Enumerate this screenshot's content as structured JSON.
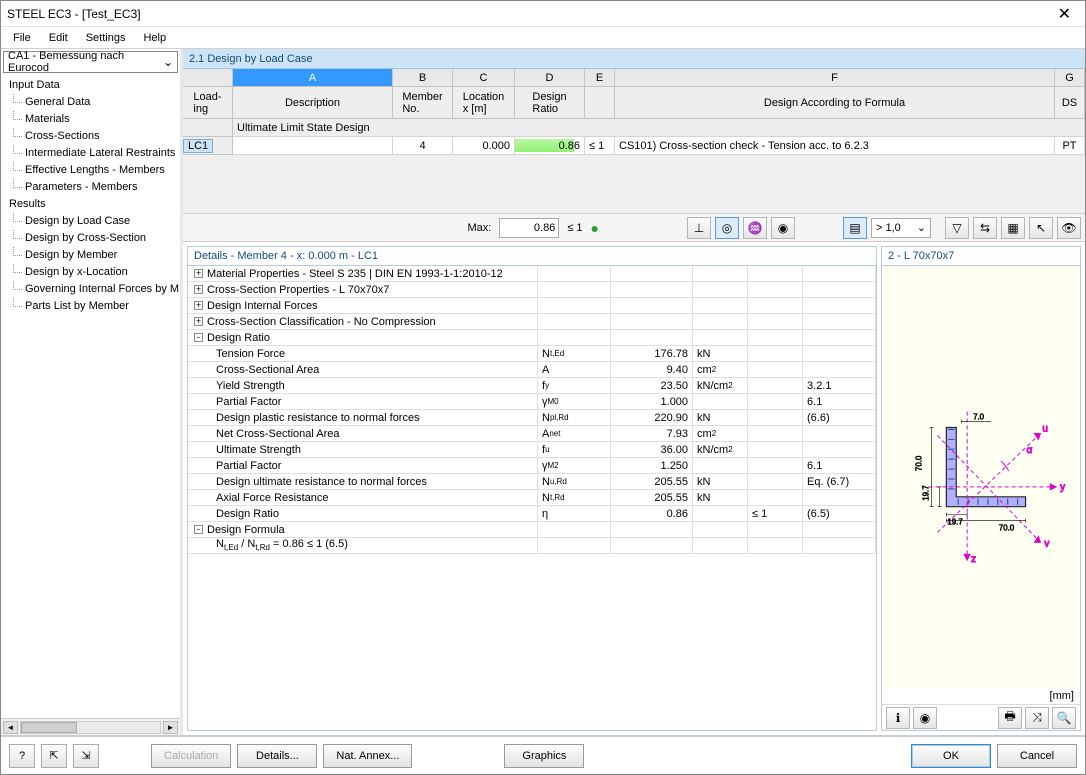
{
  "window": {
    "title": "STEEL EC3 - [Test_EC3]"
  },
  "menu": {
    "file": "File",
    "edit": "Edit",
    "settings": "Settings",
    "help": "Help"
  },
  "case_combo": "CA1 - Bemessung nach Eurocod",
  "nav": {
    "input": "Input Data",
    "general": "General Data",
    "materials": "Materials",
    "xsections": "Cross-Sections",
    "ilr": "Intermediate Lateral Restraints",
    "efflen": "Effective Lengths - Members",
    "params": "Parameters - Members",
    "results": "Results",
    "dlc": "Design by Load Case",
    "dcs": "Design by Cross-Section",
    "dmem": "Design by Member",
    "dxloc": "Design by x-Location",
    "gif": "Governing Internal Forces by M",
    "pl": "Parts List by Member"
  },
  "section_title": "2.1 Design by Load Case",
  "grid": {
    "hdr_loading": "Load-\ning",
    "hdr_desc": "Description",
    "hdr_member": "Member\nNo.",
    "hdr_loc": "Location\nx [m]",
    "hdr_design": "Design\nRatio",
    "hdr_formula": "Design According to Formula",
    "hdr_ds": "DS",
    "section_row": "Ultimate Limit State Design",
    "row": {
      "lc": "LC1",
      "desc": "",
      "memno": "4",
      "x": "0.000",
      "ratio": "0.86",
      "check": "≤ 1",
      "formula": "CS101) Cross-section check - Tension acc. to 6.2.3",
      "ds": "PT"
    }
  },
  "summary": {
    "max_label": "Max:",
    "max_val": "0.86",
    "check": "≤ 1",
    "filter_val": "> 1,0"
  },
  "details": {
    "title": "Details - Member 4 - x: 0.000 m - LC1",
    "rows": [
      {
        "exp": "+",
        "name": "Material Properties - Steel S 235 | DIN EN 1993-1-1:2010-12"
      },
      {
        "exp": "+",
        "name": "Cross-Section Properties  -  L 70x70x7"
      },
      {
        "exp": "+",
        "name": "Design Internal Forces"
      },
      {
        "exp": "+",
        "name": "Cross-Section Classification - No Compression"
      },
      {
        "exp": "-",
        "name": "Design Ratio"
      },
      {
        "indent": 2,
        "name": "Tension Force",
        "sym": "N_t,Ed",
        "val": "176.78",
        "unit": "kN"
      },
      {
        "indent": 2,
        "name": "Cross-Sectional Area",
        "sym": "A",
        "val": "9.40",
        "unit": "cm²"
      },
      {
        "indent": 2,
        "name": "Yield Strength",
        "sym": "f_y",
        "val": "23.50",
        "unit": "kN/cm²",
        "ref": "3.2.1"
      },
      {
        "indent": 2,
        "name": "Partial Factor",
        "sym": "γ_M0",
        "val": "1.000",
        "ref": "6.1"
      },
      {
        "indent": 2,
        "name": "Design plastic resistance to normal forces",
        "sym": "N_pl,Rd",
        "val": "220.90",
        "unit": "kN",
        "ref": "(6.6)"
      },
      {
        "indent": 2,
        "name": "Net Cross-Sectional Area",
        "sym": "A_net",
        "val": "7.93",
        "unit": "cm²"
      },
      {
        "indent": 2,
        "name": "Ultimate Strength",
        "sym": "f_u",
        "val": "36.00",
        "unit": "kN/cm²"
      },
      {
        "indent": 2,
        "name": "Partial Factor",
        "sym": "γ_M2",
        "val": "1.250",
        "ref": "6.1"
      },
      {
        "indent": 2,
        "name": "Design ultimate resistance to normal forces",
        "sym": "N_u,Rd",
        "val": "205.55",
        "unit": "kN",
        "ref": "Eq. (6.7)"
      },
      {
        "indent": 2,
        "name": "Axial Force Resistance",
        "sym": "N_t,Rd",
        "val": "205.55",
        "unit": "kN"
      },
      {
        "indent": 2,
        "name": "Design Ratio",
        "sym": "η",
        "val": "0.86",
        "chk": "≤ 1",
        "ref": "(6.5)"
      },
      {
        "exp": "-",
        "name": "Design Formula"
      },
      {
        "indent": 2,
        "name": "N_t,Ed / N_t,Rd = 0.86 ≤ 1   (6.5)"
      }
    ]
  },
  "preview": {
    "title": "2 - L 70x70x7",
    "unit": "[mm]",
    "dims": {
      "h": "70.0",
      "w": "70.0",
      "t1": "7.0",
      "off": "19.7"
    },
    "axes": {
      "u": "u",
      "v": "v",
      "y": "y",
      "z": "z",
      "alpha": "α"
    }
  },
  "footer": {
    "calc": "Calculation",
    "details": "Details...",
    "annex": "Nat. Annex...",
    "graphics": "Graphics",
    "ok": "OK",
    "cancel": "Cancel"
  }
}
